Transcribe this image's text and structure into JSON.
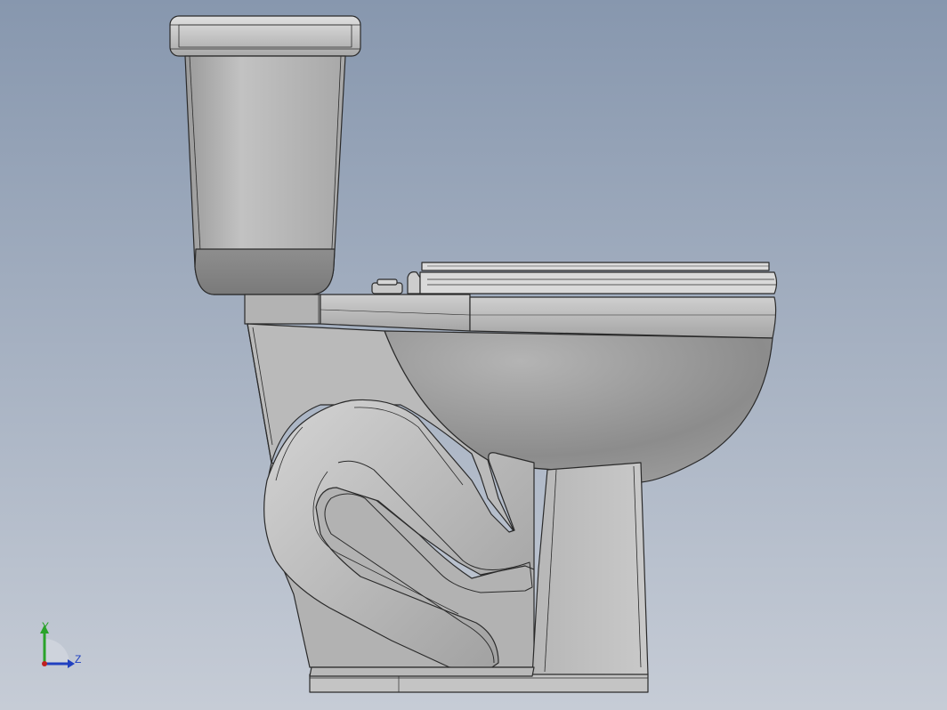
{
  "viewport": {
    "background_top": "#8797ae",
    "background_bottom": "#c6ccd6"
  },
  "model": {
    "shaded_color": "#bdbdbd",
    "edge_color": "#2a2a2a"
  },
  "triad": {
    "y_label": "Y",
    "z_label": "Z",
    "y_color": "#2aa32a",
    "z_color": "#2040c0",
    "origin_color": "#c02020"
  }
}
